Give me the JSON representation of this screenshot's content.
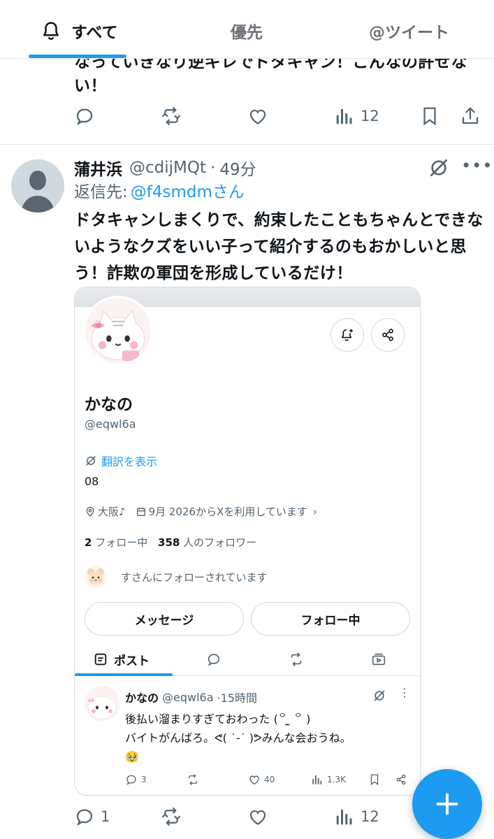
{
  "tabs": [
    {
      "label": "すべて",
      "active": true
    },
    {
      "label": "優先"
    },
    {
      "label": "@ツイート"
    }
  ],
  "prev_tweet": {
    "text": "なっていきなり逆ギレでドタキャン！こんなの許せない！",
    "views": "12"
  },
  "tweet": {
    "name": "蒲井浜",
    "handle": "@cdijMQt",
    "dot": "·",
    "time": "49分",
    "reply_label": "返信先:",
    "reply_mention": "@f4smdmさん",
    "text": "ドタキャンしまくりで、約束したこともちゃんとできないようなクズをいい子って紹介するのもおかしいと思う！詐欺の軍団を形成しているだけ！",
    "reply_count": "1",
    "views": "12"
  },
  "card": {
    "name": "かなの",
    "handle": "@eqwl6a",
    "translate_label": "翻訳を表示",
    "bio": "08",
    "location": "大阪♪",
    "joined": "9月 2026からXを利用しています",
    "following_count": "2",
    "following_label": "フォロー中",
    "followers_count": "358",
    "followers_label": "人のフォロワー",
    "followed_by": "すさんにフォローされています",
    "message_button": "メッセージ",
    "following_button": "フォロー中",
    "tab_posts": "ポスト",
    "post": {
      "name": "かなの",
      "handle": "@eqwl6a",
      "time": "·15時間",
      "line1": "後払い溜まりすぎておわった (꒪ ̫ ꒪ )",
      "line2": "バイトがんばろ。ᕙ( ˙-˙ )ᕗみんな会おうね。",
      "line3": "🥹",
      "replies": "3",
      "likes": "40",
      "views": "1.3K"
    }
  },
  "colors": {
    "accent": "#1d9bf0",
    "text": "#0f1419",
    "muted": "#536471"
  }
}
